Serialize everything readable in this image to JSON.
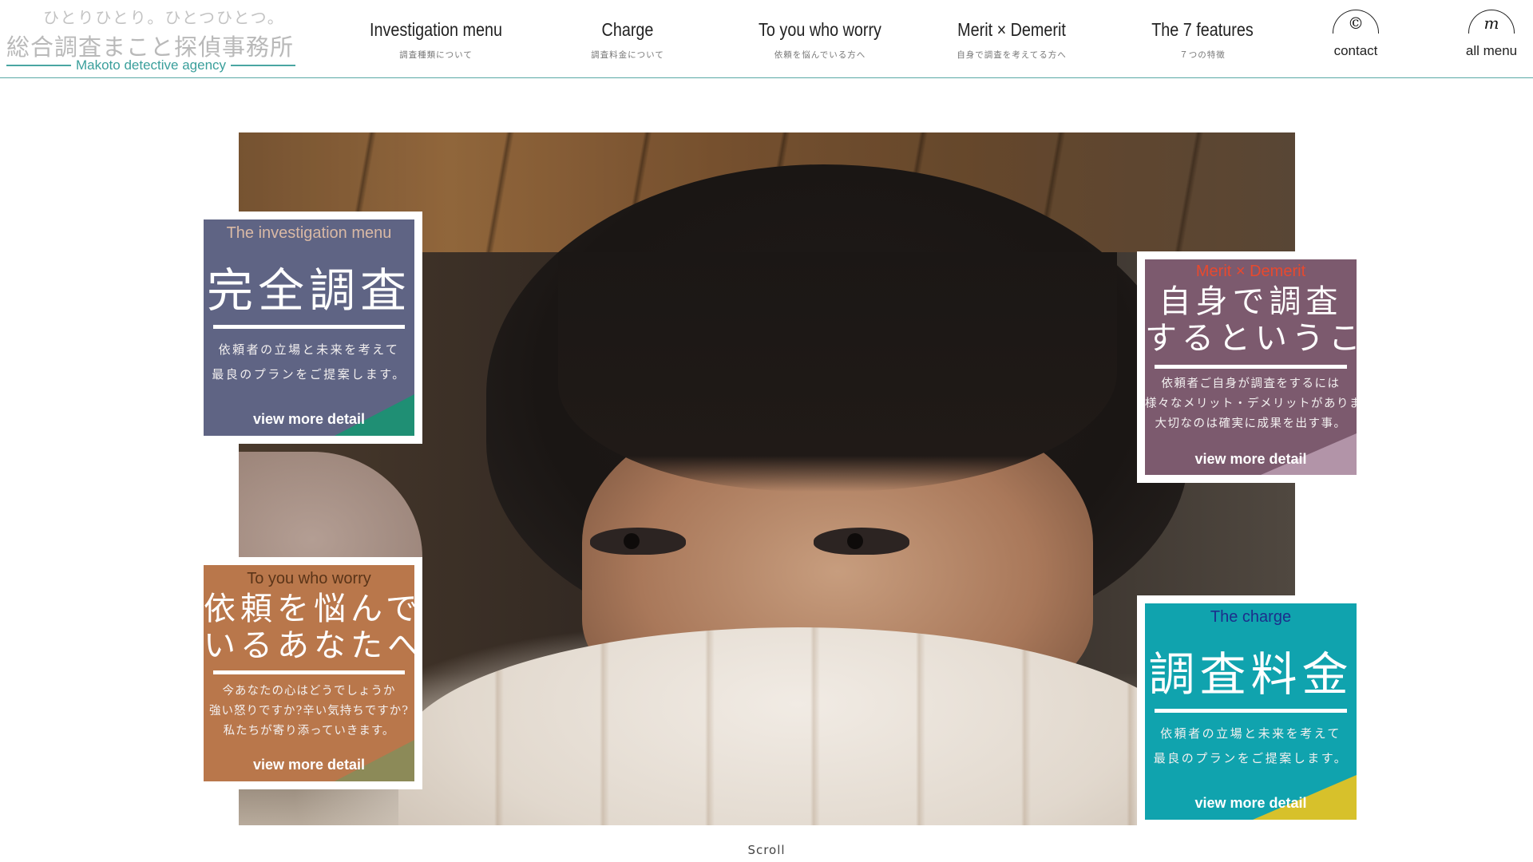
{
  "logo": {
    "tagline": "ひとりひとり。ひとつひとつ。",
    "name": "総合調査まこと探偵事務所",
    "english": "Makoto detective agency"
  },
  "nav": [
    {
      "label": "Investigation menu",
      "sub": "調査種類について"
    },
    {
      "label": "Charge",
      "sub": "調査料金について"
    },
    {
      "label": "To you who worry",
      "sub": "依頼を悩んでいる方へ"
    },
    {
      "label": "Merit × Demerit",
      "sub": "自身で調査を考えてる方へ"
    },
    {
      "label": "The 7 features",
      "sub": "７つの特徴"
    }
  ],
  "icons": {
    "contact": {
      "glyph": "©",
      "label": "contact",
      "icon": "contact-c-icon"
    },
    "all_menu": {
      "glyph": "m",
      "label": "all menu",
      "icon": "menu-m-icon"
    }
  },
  "cards": {
    "investigation": {
      "en": "The investigation menu",
      "title": "完全調査",
      "desc": [
        "依頼者の立場と未来を考えて",
        "最良のプランをご提案します。"
      ],
      "more": "view more detail",
      "en_color": "#d9b9a5"
    },
    "merit": {
      "en": "Merit × Demerit",
      "title": [
        "自身で調査",
        "するということ"
      ],
      "desc": [
        "依頼者ご自身が調査をするには",
        "様々なメリット・デメリットがあります。",
        "大切なのは確実に成果を出す事。"
      ],
      "more": "view more detail",
      "en_color": "#e8492e"
    },
    "worry": {
      "en": "To you who worry",
      "title": [
        "依頼を悩んで",
        "いるあなたへ"
      ],
      "desc": [
        "今あなたの心はどうでしょうか",
        "強い怒りですか?辛い気持ちですか?",
        "私たちが寄り添っていきます。"
      ],
      "more": "view more detail",
      "en_color": "#5a3418"
    },
    "charge": {
      "en": "The charge",
      "title": "調査料金",
      "desc": [
        "依頼者の立場と未来を考えて",
        "最良のプランをご提案します。"
      ],
      "more": "view more detail",
      "en_color": "#1c2f8c"
    }
  },
  "scroll": "Scroll"
}
